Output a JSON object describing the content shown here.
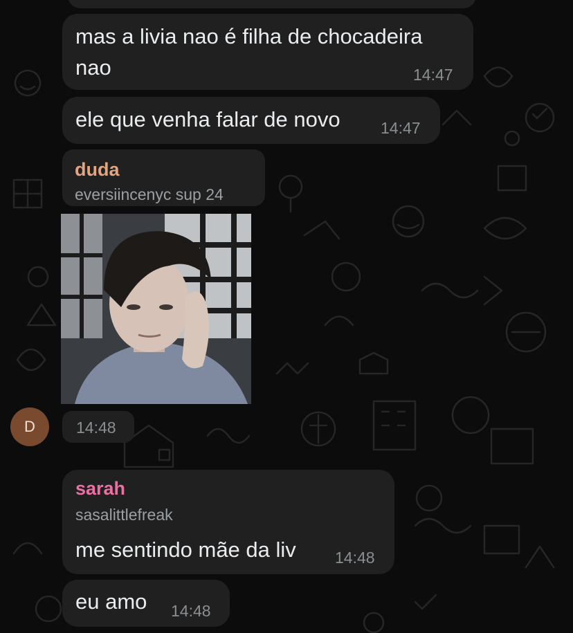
{
  "chat": {
    "messages": [
      {
        "text": "mas a livia nao é filha de chocadeira",
        "text_line2": "nao",
        "time": "14:47"
      },
      {
        "text": "ele que venha falar de novo",
        "time": "14:47"
      },
      {
        "sender": "duda",
        "handle": "eversiincenyc sup 24",
        "time": "14:48",
        "media": "photo",
        "avatar_initial": "D"
      },
      {
        "sender": "sarah",
        "handle": "sasalittlefreak",
        "text": "me sentindo mãe da liv",
        "time": "14:48"
      },
      {
        "text": "eu amo",
        "time": "14:48"
      }
    ]
  },
  "colors": {
    "background": "#0c0c0c",
    "bubble": "#202020",
    "sender_duda": "#e3a57f",
    "sender_sarah": "#ee6fa3",
    "avatar_bg": "#7a4a2e"
  },
  "icons": [
    "doodle-pattern-background"
  ]
}
